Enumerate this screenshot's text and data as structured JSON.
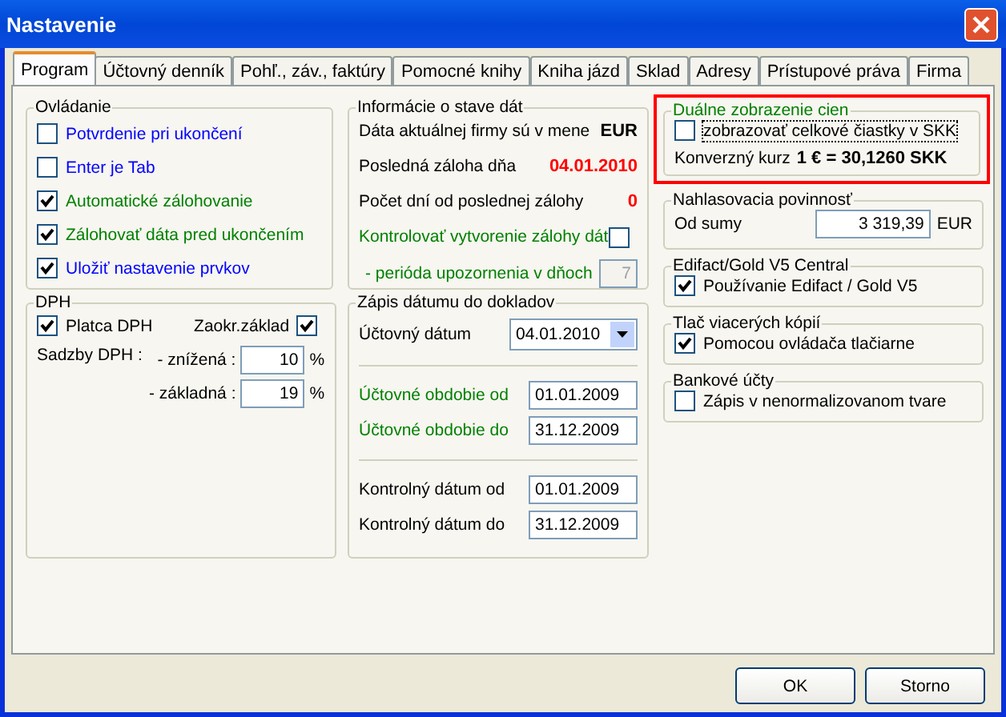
{
  "window": {
    "title": "Nastavenie"
  },
  "tabs": [
    {
      "label": "Program",
      "selected": true
    },
    {
      "label": "Účtovný denník",
      "selected": false
    },
    {
      "label": "Pohľ., záv., faktúry",
      "selected": false
    },
    {
      "label": "Pomocné knihy",
      "selected": false
    },
    {
      "label": "Kniha jázd",
      "selected": false
    },
    {
      "label": "Sklad",
      "selected": false
    },
    {
      "label": "Adresy",
      "selected": false
    },
    {
      "label": "Prístupové práva",
      "selected": false
    },
    {
      "label": "Firma",
      "selected": false
    }
  ],
  "ovladanie": {
    "title": "Ovládanie",
    "options": [
      {
        "label": "Potvrdenie pri ukončení",
        "checked": false,
        "color": "#0000ff"
      },
      {
        "label": "Enter je Tab",
        "checked": false,
        "color": "#0000ff"
      },
      {
        "label": "Automatické zálohovanie",
        "checked": true,
        "color": "#008000"
      },
      {
        "label": "Zálohovať dáta pred ukončením",
        "checked": true,
        "color": "#008000"
      },
      {
        "label": "Uložiť nastavenie prvkov",
        "checked": true,
        "color": "#0000ff"
      }
    ]
  },
  "dph": {
    "title": "DPH",
    "platca": {
      "label": "Platca DPH",
      "checked": true
    },
    "zaokr": {
      "label": "Zaokr.základ",
      "checked": true
    },
    "rates_label": "Sadzby DPH :",
    "rates": [
      {
        "label": "- znížená :",
        "value": "10",
        "unit": "%"
      },
      {
        "label": "- základná :",
        "value": "19",
        "unit": "%"
      }
    ]
  },
  "info": {
    "title": "Informácie o stave dát",
    "rows": [
      {
        "kind": "value",
        "label": "Dáta aktuálnej firmy sú v mene",
        "value": "EUR",
        "color": "#000000"
      },
      {
        "kind": "value",
        "label": "Posledná záloha dňa",
        "value": "04.01.2010",
        "color": "#ff0000"
      },
      {
        "kind": "value",
        "label": "Počet dní od poslednej zálohy",
        "value": "0",
        "color": "#ff0000"
      },
      {
        "kind": "checkbox",
        "label": "Kontrolovať vytvorenie zálohy dát",
        "checked": false
      },
      {
        "kind": "field",
        "label": "- perióda upozornenia v dňoch",
        "value": "7",
        "disabled": true
      }
    ]
  },
  "zapis": {
    "title": "Zápis dátumu do dokladov",
    "date_field": {
      "label": "Účtovný dátum",
      "value": "04.01.2010"
    },
    "periods": [
      {
        "label": "Účtovné obdobie od",
        "value": "01.01.2009"
      },
      {
        "label": "Účtovné obdobie do",
        "value": "31.12.2009"
      }
    ],
    "control": [
      {
        "label": "Kontrolný dátum od",
        "value": "01.01.2009"
      },
      {
        "label": "Kontrolný dátum do",
        "value": "31.12.2009"
      }
    ]
  },
  "dual": {
    "title": "Duálne zobrazenie cien",
    "option": {
      "label": "zobrazovať celkové čiastky v SKK",
      "checked": false
    },
    "rate_label": "Konverzný kurz",
    "rate_value": "1 € = 30,1260 SKK"
  },
  "nahlasovacia": {
    "title": "Nahlasovacia povinnosť",
    "label": "Od sumy",
    "value": "3 319,39",
    "unit": "EUR"
  },
  "edifact": {
    "title": "Edifact/Gold V5 Central",
    "option": {
      "label": "Používanie Edifact / Gold V5",
      "checked": true
    }
  },
  "tlac": {
    "title": "Tlač viacerých kópií",
    "option": {
      "label": "Pomocou ovládača tlačiarne",
      "checked": true
    }
  },
  "bankove": {
    "title": "Bankové účty",
    "option": {
      "label": "Zápis v nenormalizovanom tvare",
      "checked": false
    }
  },
  "buttons": [
    {
      "label": "OK"
    },
    {
      "label": "Storno"
    }
  ]
}
